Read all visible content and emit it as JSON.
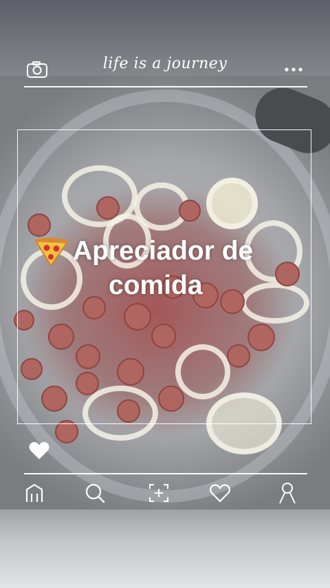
{
  "header": {
    "title": "life is a journey",
    "left_icon": "camera-icon",
    "right_icon": "more-dots-icon"
  },
  "overlay": {
    "emoji": "🍕",
    "line1": "Apreciador  de",
    "line2": "comida"
  },
  "actions": {
    "like_icon": "heart-icon"
  },
  "bottom_nav": {
    "items": [
      {
        "icon": "home-icon"
      },
      {
        "icon": "search-icon"
      },
      {
        "icon": "add-post-icon"
      },
      {
        "icon": "heart-outline-icon"
      },
      {
        "icon": "profile-icon"
      }
    ]
  },
  "colors": {
    "overlay_text": "#ffffff",
    "lines": "#ffffff"
  }
}
